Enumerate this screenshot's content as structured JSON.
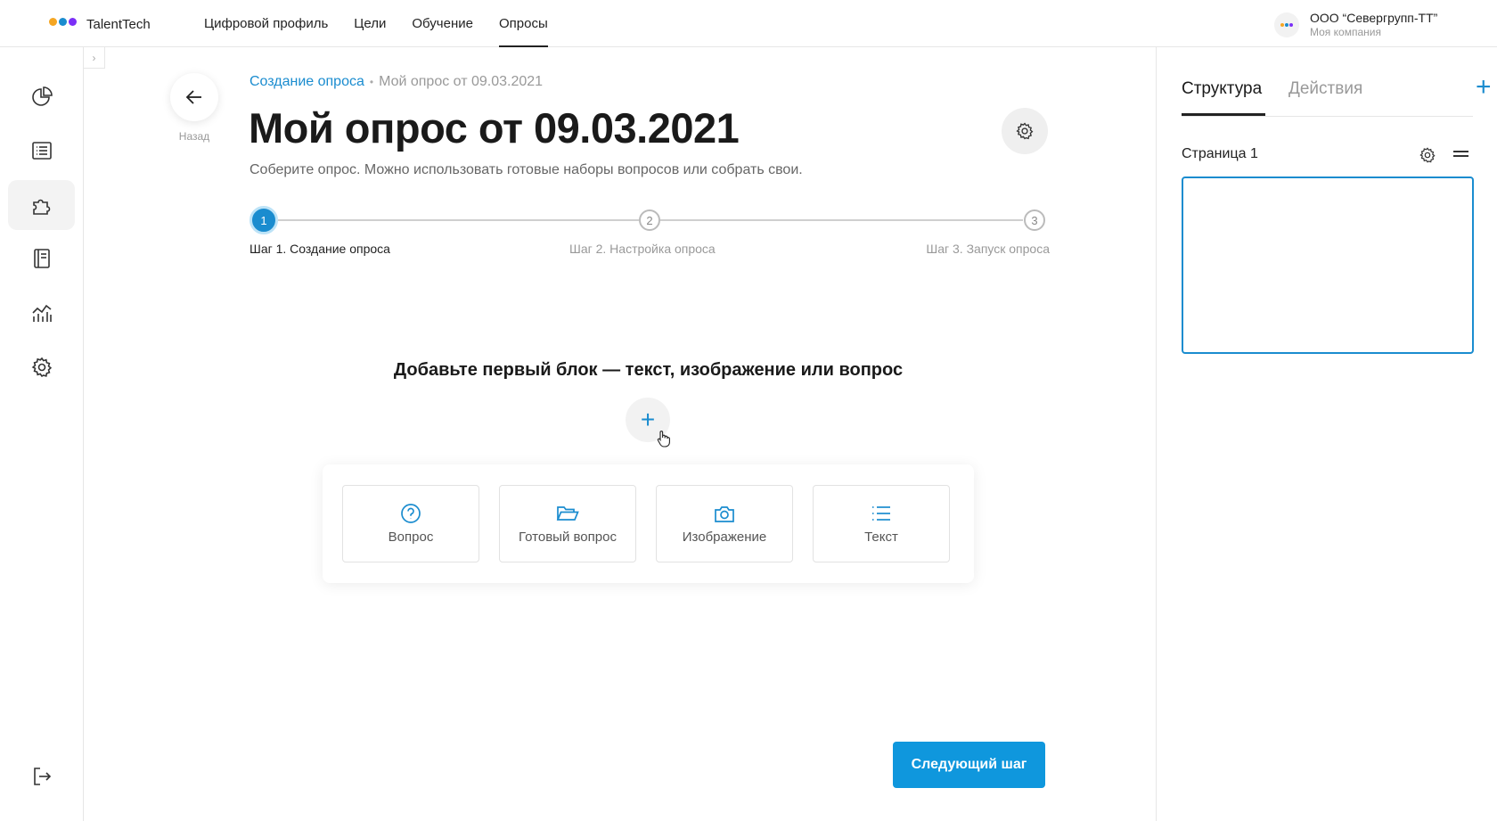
{
  "app": {
    "name": "TalentTech",
    "logo_colors": [
      "#f5a623",
      "#1a8ccf",
      "#7b2ff7"
    ]
  },
  "topnav": {
    "items": [
      {
        "label": "Цифровой профиль",
        "active": false
      },
      {
        "label": "Цели",
        "active": false
      },
      {
        "label": "Обучение",
        "active": false
      },
      {
        "label": "Опросы",
        "active": true
      }
    ]
  },
  "company": {
    "name": "ООО “Севергрупп-ТТ”",
    "subtitle": "Моя компания"
  },
  "sidebar": {
    "items": [
      {
        "icon": "pie-chart-icon",
        "active": false
      },
      {
        "icon": "list-icon",
        "active": false
      },
      {
        "icon": "puzzle-icon",
        "active": true
      },
      {
        "icon": "book-icon",
        "active": false
      },
      {
        "icon": "analytics-icon",
        "active": false
      },
      {
        "icon": "gear-icon",
        "active": false
      }
    ],
    "bottom_icon": "logout-icon"
  },
  "back": {
    "label": "Назад"
  },
  "breadcrumb": {
    "link": "Создание опроса",
    "separator": "•",
    "current": "Мой опрос от 09.03.2021"
  },
  "header": {
    "title": "Мой опрос от 09.03.2021",
    "subtitle": "Соберите опрос. Можно использовать готовые наборы вопросов или собрать свои."
  },
  "stepper": {
    "steps": [
      {
        "number": "1",
        "label": "Шаг 1. Создание опроса",
        "active": true
      },
      {
        "number": "2",
        "label": "Шаг 2. Настройка опроса",
        "active": false
      },
      {
        "number": "3",
        "label": "Шаг 3. Запуск опроса",
        "active": false
      }
    ]
  },
  "content": {
    "add_title": "Добавьте первый блок — текст, изображение или вопрос",
    "add_symbol": "+"
  },
  "blocks": [
    {
      "label": "Вопрос",
      "icon": "question-icon"
    },
    {
      "label": "Готовый вопрос",
      "icon": "folder-icon"
    },
    {
      "label": "Изображение",
      "icon": "camera-icon"
    },
    {
      "label": "Текст",
      "icon": "text-list-icon"
    }
  ],
  "next_button": {
    "label": "Следующий шаг"
  },
  "right_panel": {
    "tabs": [
      {
        "label": "Структура",
        "active": true
      },
      {
        "label": "Действия",
        "active": false
      }
    ],
    "add_symbol": "+",
    "page_label": "Страница 1"
  },
  "colors": {
    "accent": "#1a8ccf",
    "button": "#0f97dd"
  }
}
